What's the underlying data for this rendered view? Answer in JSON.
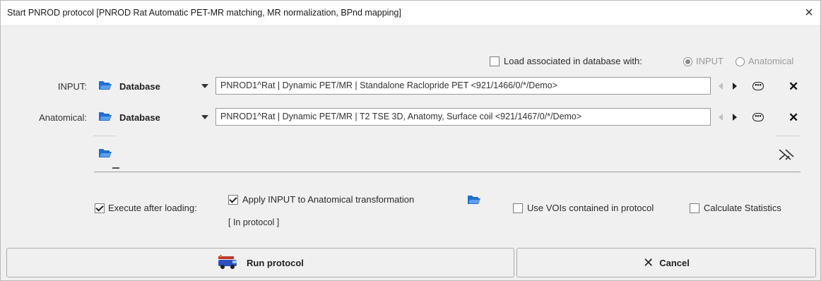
{
  "window": {
    "title": "Start PNROD protocol [PNROD Rat Automatic PET-MR matching, MR normalization, BPnd mapping]",
    "close_glyph": "×"
  },
  "load_assoc": {
    "checkbox_label": "Load associated in database with:",
    "checked": false,
    "radio_input_label": "INPUT",
    "radio_anatomical_label": "Anatomical",
    "selected": "INPUT"
  },
  "sources": [
    {
      "label": "INPUT:",
      "source_type": "Database",
      "path": "PNROD1^Rat | Dynamic PET/MR | Standalone Raclopride PET <921/1466/0/*/Demo>",
      "icon": "folder-icon"
    },
    {
      "label": "Anatomical:",
      "source_type": "Database",
      "path": "PNROD1^Rat | Dynamic PET/MR | T2 TSE 3D, Anatomy, Surface coil <921/1467/0/*/Demo>",
      "icon": "folder-icon"
    }
  ],
  "options": {
    "execute_after_loading": {
      "label": "Execute after loading:",
      "checked": true
    },
    "apply_transform": {
      "label": "Apply INPUT to Anatomical transformation",
      "checked": true
    },
    "in_protocol_label": "[ In protocol ]",
    "use_vois": {
      "label": "Use VOIs contained in protocol",
      "checked": false
    },
    "calc_stats": {
      "label": "Calculate Statistics",
      "checked": false
    }
  },
  "buttons": {
    "run_label": "Run protocol",
    "cancel_label": "Cancel",
    "cancel_glyph": "✕",
    "collapse_glyph": "✕"
  },
  "colors": {
    "folder_blue": "#1f6fd1",
    "window_bg": "#f0f0f0"
  }
}
